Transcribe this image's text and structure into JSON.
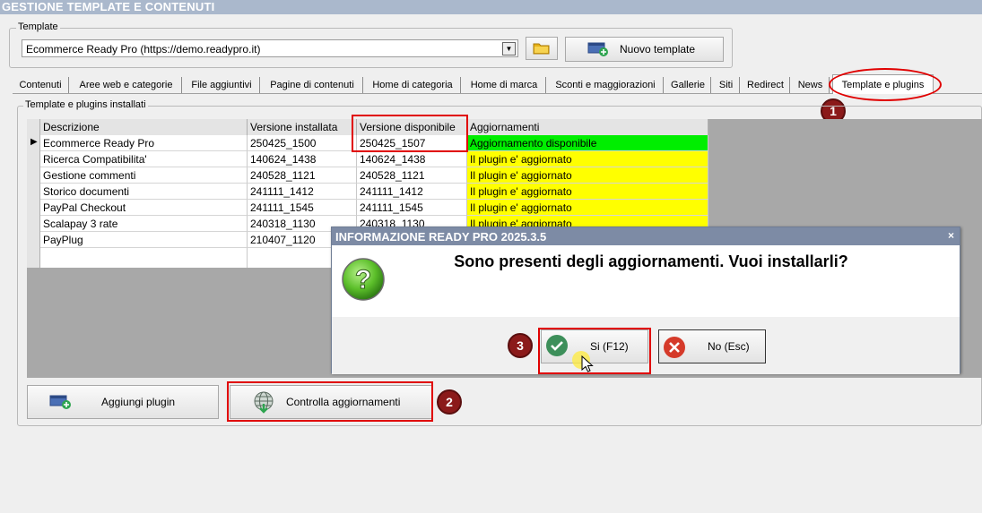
{
  "window": {
    "title": "GESTIONE TEMPLATE E CONTENUTI"
  },
  "template_group": {
    "legend": "Template",
    "selected": "Ecommerce Ready Pro (https://demo.readypro.it)",
    "new_button": "Nuovo template"
  },
  "tabs": [
    {
      "label": "Contenuti"
    },
    {
      "label": "Aree web e categorie"
    },
    {
      "label": "File aggiuntivi"
    },
    {
      "label": "Pagine di contenuti"
    },
    {
      "label": "Home di categoria"
    },
    {
      "label": "Home di marca"
    },
    {
      "label": "Sconti e maggiorazioni"
    },
    {
      "label": "Gallerie"
    },
    {
      "label": "Siti"
    },
    {
      "label": "Redirect"
    },
    {
      "label": "News"
    },
    {
      "label": "Template e plugins"
    }
  ],
  "plugins": {
    "legend": "Template e plugins installati",
    "columns": [
      "Descrizione",
      "Versione installata",
      "Versione disponibile",
      "Aggiornamenti"
    ],
    "rows": [
      {
        "desc": "Ecommerce Ready Pro",
        "installed": "250425_1500",
        "available": "250425_1507",
        "status": "Aggiornamento disponibile"
      },
      {
        "desc": "Ricerca Compatibilita'",
        "installed": "140624_1438",
        "available": "140624_1438",
        "status": "Il plugin e' aggiornato"
      },
      {
        "desc": "Gestione commenti",
        "installed": "240528_1121",
        "available": "240528_1121",
        "status": "Il plugin e' aggiornato"
      },
      {
        "desc": "Storico documenti",
        "installed": "241111_1412",
        "available": "241111_1412",
        "status": "Il plugin e' aggiornato"
      },
      {
        "desc": "PayPal Checkout",
        "installed": "241111_1545",
        "available": "241111_1545",
        "status": "Il plugin e' aggiornato"
      },
      {
        "desc": "Scalapay 3 rate",
        "installed": "240318_1130",
        "available": "240318_1130",
        "status": "Il plugin e' aggiornato"
      },
      {
        "desc": "PayPlug",
        "installed": "210407_1120",
        "available": "",
        "status": ""
      }
    ],
    "colors": {
      "update_available": "#00ee00",
      "up_to_date": "#ffff00"
    },
    "add_button": "Aggiungi plugin",
    "check_button": "Controlla aggiornamenti"
  },
  "dialog": {
    "title": "INFORMAZIONE READY PRO 2025.3.5",
    "close": "×",
    "message": "Sono presenti degli aggiornamenti. Vuoi installarli?",
    "yes_button": "Si (F12)",
    "no_button": "No (Esc)"
  },
  "markers": [
    "1",
    "2",
    "3"
  ]
}
